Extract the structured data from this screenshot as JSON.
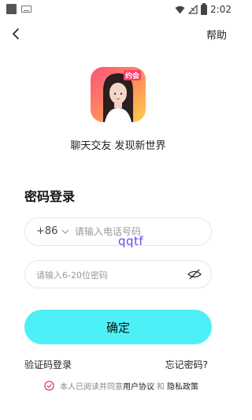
{
  "status_bar": {
    "time": "2:02"
  },
  "header": {
    "help_label": "帮助"
  },
  "brand": {
    "icon_badge": "约会",
    "slogan": "聊天交友 发现新世界"
  },
  "form": {
    "title": "密码登录",
    "country_code": "+86",
    "phone_placeholder": "请输入电话号码",
    "password_placeholder": "请输入6-20位密码",
    "confirm_label": "确定"
  },
  "watermark": "qqtf",
  "links": {
    "sms_login": "验证码登录",
    "forgot_password": "忘记密码?"
  },
  "agreement": {
    "prefix": "本人已阅读并同意",
    "user_agreement": "用户协议",
    "and": "和",
    "privacy_policy": "隐私政策"
  },
  "colors": {
    "accent": "#4ef0f7",
    "check": "#e0245e"
  }
}
